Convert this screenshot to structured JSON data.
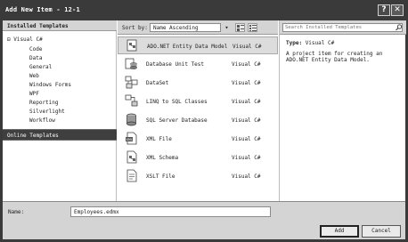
{
  "window": {
    "title": "Add New Item - 12-1",
    "help_glyph": "?",
    "close_glyph": "✕"
  },
  "left_panel": {
    "header": "Installed Templates",
    "root": "⊟ Visual C#",
    "children": [
      "Code",
      "Data",
      "General",
      "Web",
      "Windows Forms",
      "WPF",
      "Reporting",
      "Silverlight",
      "Workflow"
    ],
    "online": "Online Templates"
  },
  "toolbar": {
    "sort_label": "Sort by:",
    "sort_value": "Name Ascending",
    "sort_arrow": "▾"
  },
  "items": [
    {
      "name": "ADO.NET Entity Data Model",
      "lang": "Visual C#",
      "icon": "entity-model-icon",
      "selected": true
    },
    {
      "name": "Database Unit Test",
      "lang": "Visual C#",
      "icon": "database-unit-test-icon",
      "selected": false
    },
    {
      "name": "DataSet",
      "lang": "Visual C#",
      "icon": "dataset-icon",
      "selected": false
    },
    {
      "name": "LINQ to SQL Classes",
      "lang": "Visual C#",
      "icon": "linq-to-sql-icon",
      "selected": false
    },
    {
      "name": "SQL Server Database",
      "lang": "Visual C#",
      "icon": "sql-database-icon",
      "selected": false
    },
    {
      "name": "XML File",
      "lang": "Visual C#",
      "icon": "xml-file-icon",
      "selected": false
    },
    {
      "name": "XML Schema",
      "lang": "Visual C#",
      "icon": "xml-schema-icon",
      "selected": false
    },
    {
      "name": "XSLT File",
      "lang": "Visual C#",
      "icon": "xslt-file-icon",
      "selected": false
    }
  ],
  "right_panel": {
    "search_placeholder": "Search Installed Templates",
    "type_label": "Type:",
    "type_value": "Visual C#",
    "description": "A project item for creating an ADO.NET Entity Data Model."
  },
  "bottom": {
    "name_label": "Name:",
    "name_value": "Employees.edmx",
    "add_label": "Add",
    "cancel_label": "Cancel"
  },
  "colors": {
    "titlebar": "#3a3a3a",
    "panel_header": "#d4d4d4",
    "online_bg": "#3f3f3f",
    "selected_item": "#dcdcdc"
  }
}
